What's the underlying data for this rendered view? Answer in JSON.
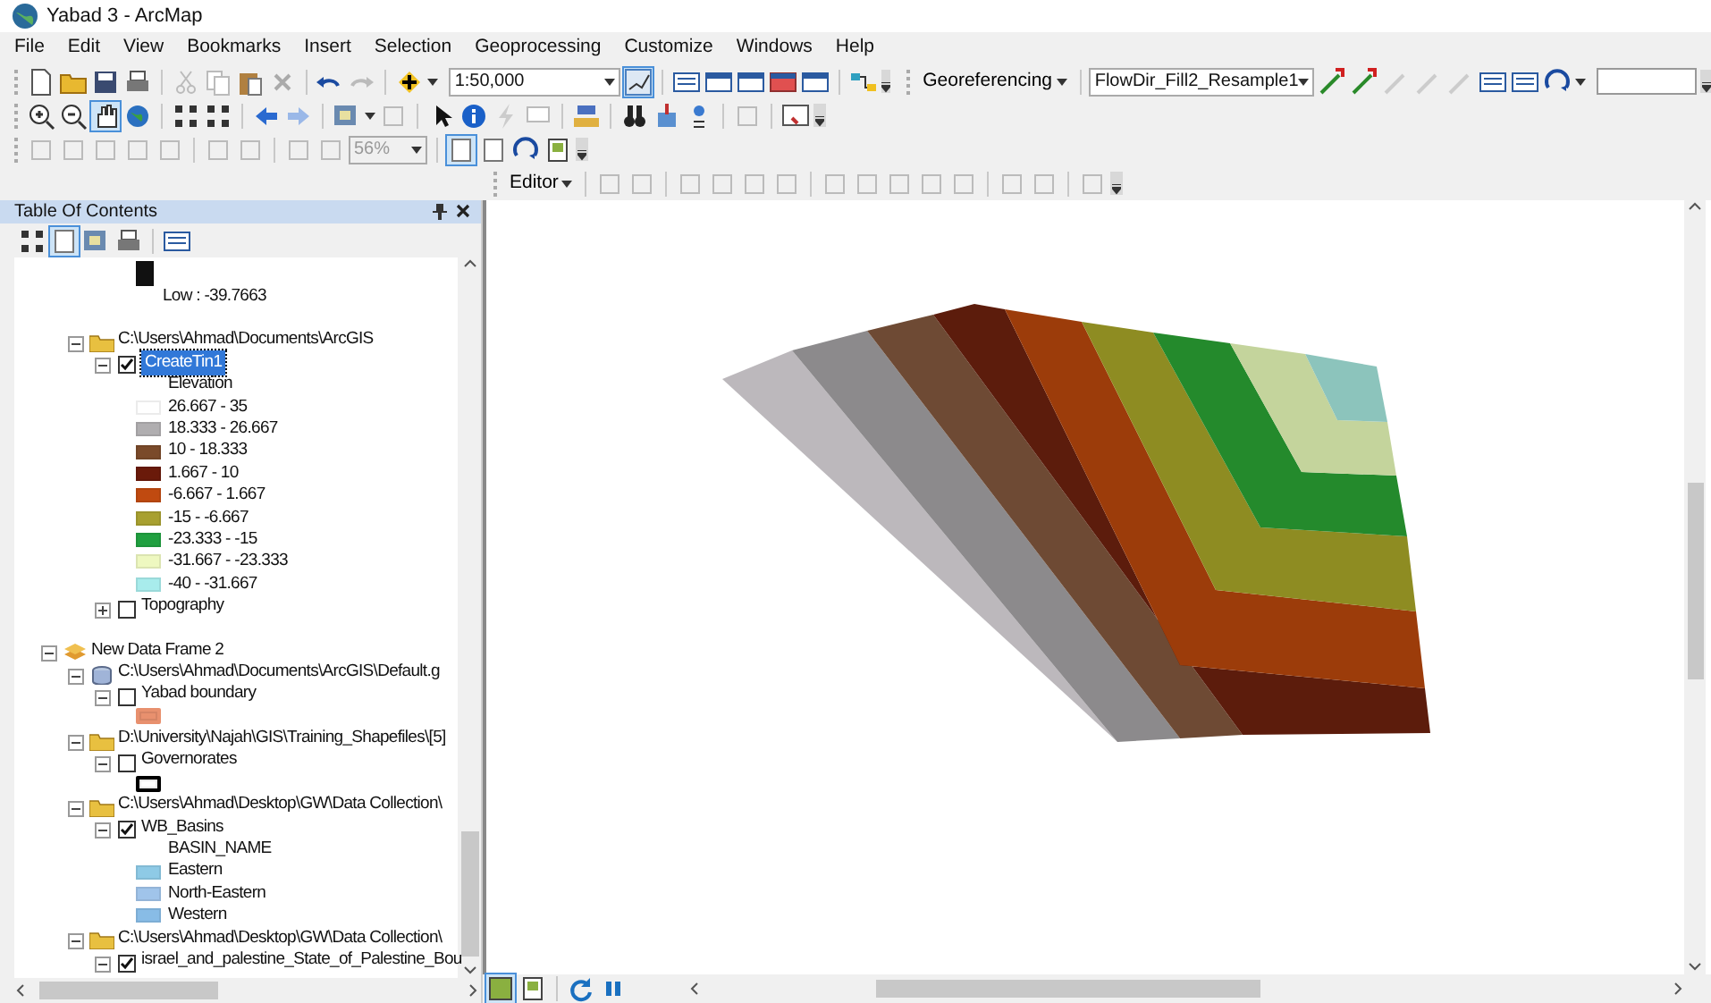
{
  "window": {
    "title": "Yabad 3 - ArcMap"
  },
  "menu": [
    "File",
    "Edit",
    "View",
    "Bookmarks",
    "Insert",
    "Selection",
    "Geoprocessing",
    "Customize",
    "Windows",
    "Help"
  ],
  "standard_toolbar": {
    "scale": "1:50,000"
  },
  "georeferencing_toolbar": {
    "label": "Georeferencing",
    "layer": "FlowDir_Fill2_Resample1"
  },
  "layout_toolbar": {
    "zoom": "56%"
  },
  "editor_toolbar": {
    "label": "Editor"
  },
  "table_of_contents": {
    "title": "Table Of Contents",
    "items": [
      {
        "kind": "ramp",
        "color": "#111111"
      },
      {
        "kind": "note",
        "label": "Low : -39.7663"
      },
      {
        "kind": "folder",
        "label": "C:\\Users\\Ahmad\\Documents\\ArcGIS",
        "expanded": true,
        "children": [
          {
            "kind": "layer",
            "label": "CreateTin1",
            "expanded": true,
            "checked": true,
            "selected": true,
            "children": [
              {
                "kind": "heading",
                "label": "Elevation"
              },
              {
                "kind": "class",
                "label": "26.667 - 35",
                "color": "#ffffff"
              },
              {
                "kind": "class",
                "label": "18.333 - 26.667",
                "color": "#b0aeb0"
              },
              {
                "kind": "class",
                "label": "10 - 18.333",
                "color": "#7a4a2a"
              },
              {
                "kind": "class",
                "label": "1.667 - 10",
                "color": "#6a1a0a"
              },
              {
                "kind": "class",
                "label": "-6.667 - 1.667",
                "color": "#c04a10"
              },
              {
                "kind": "class",
                "label": "-15 - -6.667",
                "color": "#a8a030"
              },
              {
                "kind": "class",
                "label": "-23.333 - -15",
                "color": "#20a040"
              },
              {
                "kind": "class",
                "label": "-31.667 - -23.333",
                "color": "#eef8c0"
              },
              {
                "kind": "class",
                "label": "-40 - -31.667",
                "color": "#a8ecec"
              }
            ]
          },
          {
            "kind": "layer",
            "label": "Topography",
            "expanded": false,
            "checked": false,
            "selected": false
          }
        ]
      },
      {
        "kind": "data_frame",
        "label": "New Data Frame 2",
        "expanded": true,
        "children": [
          {
            "kind": "database",
            "label": "C:\\Users\\Ahmad\\Documents\\ArcGIS\\Default.g",
            "expanded": true,
            "children": [
              {
                "kind": "layer",
                "label": "Yabad boundary",
                "expanded": true,
                "checked": false,
                "selected": false,
                "children": [
                  {
                    "kind": "patch",
                    "color": "#e8906e"
                  }
                ]
              }
            ]
          },
          {
            "kind": "folder",
            "label": "D:\\University\\Najah\\GIS\\Training_Shapefiles\\[5]",
            "expanded": true,
            "children": [
              {
                "kind": "layer",
                "label": "Governorates",
                "expanded": true,
                "checked": false,
                "selected": false,
                "children": [
                  {
                    "kind": "patch",
                    "color": "#000000"
                  }
                ]
              }
            ]
          },
          {
            "kind": "folder",
            "label": "C:\\Users\\Ahmad\\Desktop\\GW\\Data Collection\\",
            "expanded": true,
            "children": [
              {
                "kind": "layer",
                "label": "WB_Basins",
                "expanded": true,
                "checked": true,
                "selected": false,
                "children": [
                  {
                    "kind": "heading",
                    "label": "BASIN_NAME"
                  },
                  {
                    "kind": "class",
                    "label": "Eastern",
                    "color": "#8ecae6"
                  },
                  {
                    "kind": "class",
                    "label": "North-Eastern",
                    "color": "#a0c4ea"
                  },
                  {
                    "kind": "class",
                    "label": "Western",
                    "color": "#88bce6"
                  }
                ]
              }
            ]
          },
          {
            "kind": "folder",
            "label": "C:\\Users\\Ahmad\\Desktop\\GW\\Data Collection\\",
            "expanded": true,
            "children": [
              {
                "kind": "layer",
                "label": "israel_and_palestine_State_of_Palestine_Bou",
                "expanded": true,
                "checked": true,
                "selected": false
              }
            ]
          }
        ]
      }
    ]
  }
}
